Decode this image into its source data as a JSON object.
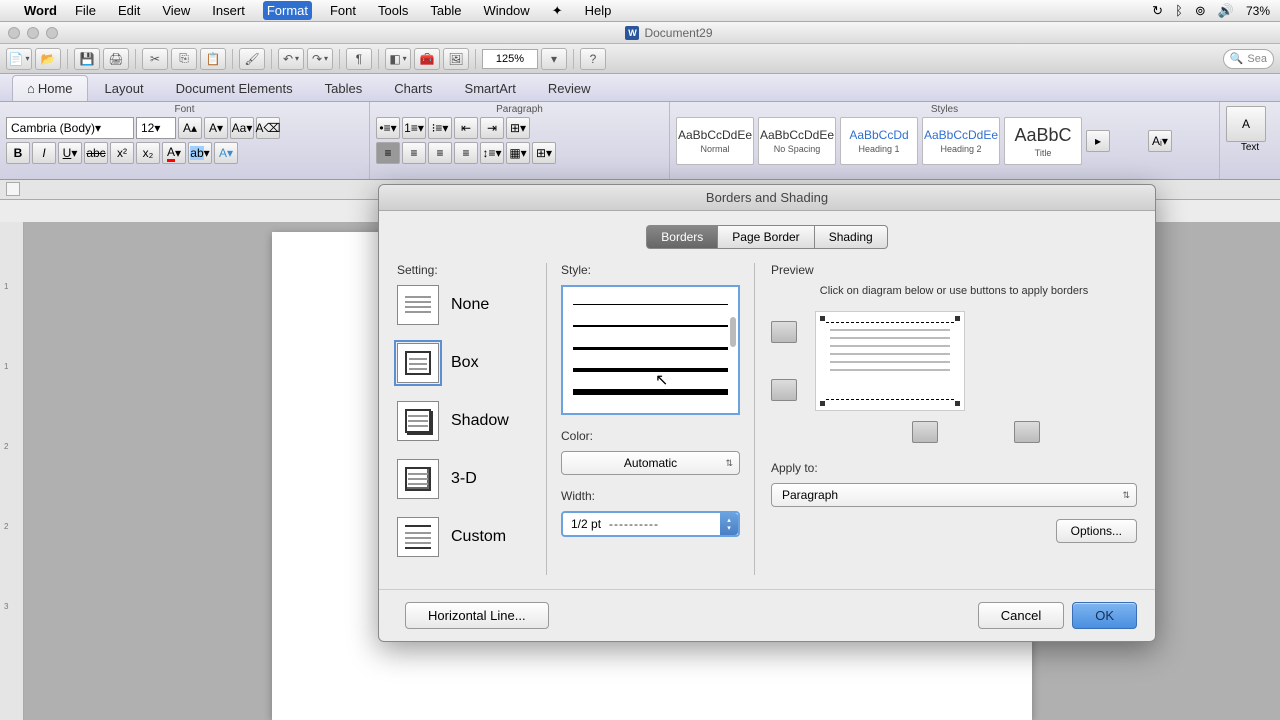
{
  "menubar": {
    "app": "Word",
    "items": [
      "File",
      "Edit",
      "View",
      "Insert",
      "Format",
      "Font",
      "Tools",
      "Table",
      "Window"
    ],
    "active_index": 4,
    "help": "Help",
    "battery": "73%"
  },
  "window": {
    "title": "Document29"
  },
  "toolbar": {
    "zoom": "125%",
    "search_placeholder": "Sea"
  },
  "ribbon": {
    "tabs": [
      "Home",
      "Layout",
      "Document Elements",
      "Tables",
      "Charts",
      "SmartArt",
      "Review"
    ],
    "active_index": 0,
    "groups": {
      "font": "Font",
      "paragraph": "Paragraph",
      "styles": "Styles"
    },
    "font_name": "Cambria (Body)",
    "font_size": "12",
    "styles_gallery": [
      {
        "sample": "AaBbCcDdEe",
        "label": "Normal"
      },
      {
        "sample": "AaBbCcDdEe",
        "label": "No Spacing"
      },
      {
        "sample": "AaBbCcDd",
        "label": "Heading 1"
      },
      {
        "sample": "AaBbCcDdEe",
        "label": "Heading 2"
      },
      {
        "sample": "AaBbC",
        "label": "Title"
      }
    ],
    "text_label": "Text"
  },
  "dialog": {
    "title": "Borders and Shading",
    "tabs": [
      "Borders",
      "Page Border",
      "Shading"
    ],
    "active_tab": 0,
    "setting_label": "Setting:",
    "settings": [
      "None",
      "Box",
      "Shadow",
      "3-D",
      "Custom"
    ],
    "selected_setting": 1,
    "style_label": "Style:",
    "color_label": "Color:",
    "color_value": "Automatic",
    "width_label": "Width:",
    "width_value": "1/2 pt",
    "preview_label": "Preview",
    "preview_hint": "Click on diagram below or use buttons to apply borders",
    "apply_to_label": "Apply to:",
    "apply_to_value": "Paragraph",
    "options_btn": "Options...",
    "hline_btn": "Horizontal Line...",
    "cancel": "Cancel",
    "ok": "OK"
  }
}
